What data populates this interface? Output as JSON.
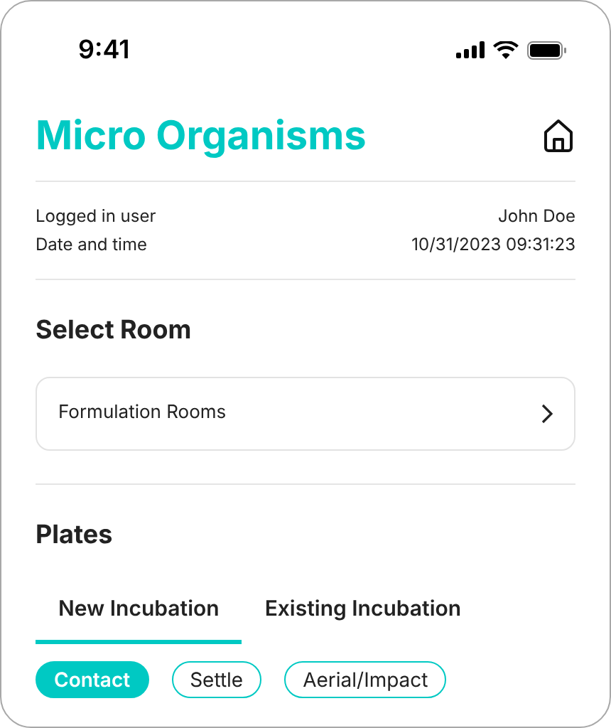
{
  "status_bar": {
    "time": "9:41"
  },
  "header": {
    "title": "Micro Organisms"
  },
  "info": [
    {
      "label": "Logged in user",
      "value": "John Doe"
    },
    {
      "label": "Date and time",
      "value": "10/31/2023 09:31:23"
    }
  ],
  "select_room": {
    "heading": "Select Room",
    "value": "Formulation Rooms"
  },
  "plates": {
    "heading": "Plates",
    "tabs": [
      {
        "label": "New Incubation",
        "selected": true
      },
      {
        "label": "Existing Incubation",
        "selected": false
      }
    ],
    "chips": [
      {
        "label": "Contact",
        "selected": true
      },
      {
        "label": "Settle",
        "selected": false
      },
      {
        "label": "Aerial/Impact",
        "selected": false
      }
    ]
  }
}
